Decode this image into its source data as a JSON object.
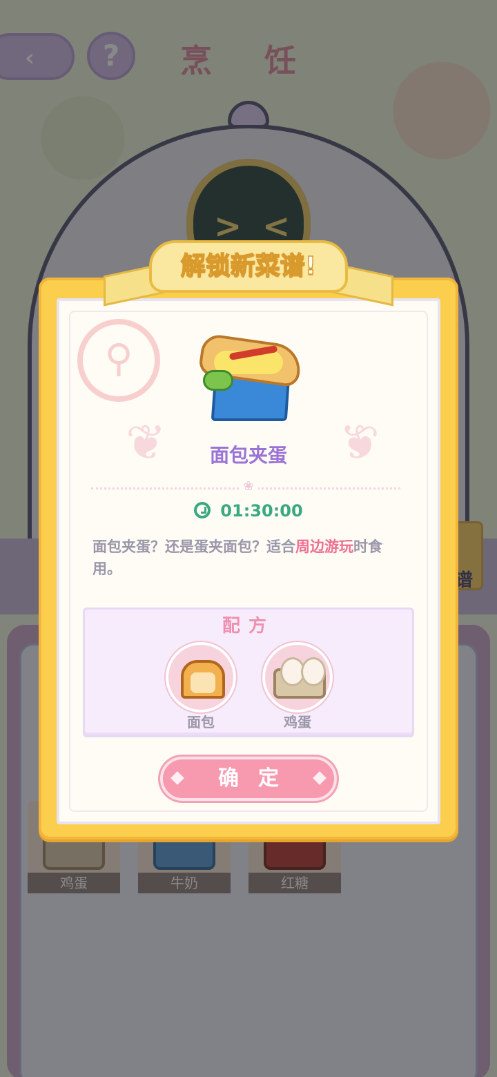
{
  "scene": {
    "title": "烹 饪",
    "help_label": "?",
    "back_label": "‹",
    "side_book_label": "谱"
  },
  "inventory": [
    {
      "label": "鸡蛋",
      "icon": "egg-carton-icon"
    },
    {
      "label": "牛奶",
      "icon": "milk-carton-icon"
    },
    {
      "label": "红糖",
      "icon": "brown-sugar-bag-icon"
    }
  ],
  "popup": {
    "banner": "解锁新菜谱!",
    "dish_icon": "egg-sandwich-icon",
    "dish_name": "面包夹蛋",
    "cook_time": "01:30:00",
    "description_parts": [
      "面包夹蛋？还是蛋夹面包？适合",
      "周边游玩",
      "时食用。"
    ],
    "recipe_title": "配方",
    "ingredients": [
      {
        "label": "面包",
        "icon": "bread-icon"
      },
      {
        "label": "鸡蛋",
        "icon": "egg-carton-icon"
      }
    ],
    "confirm_label": "确定"
  },
  "colors": {
    "popup_frame": "#fbcf4d",
    "accent_purple": "#9b73d6",
    "accent_pink": "#ef6f92",
    "timer_green": "#3aa882",
    "button_pink": "#f79aaf"
  }
}
